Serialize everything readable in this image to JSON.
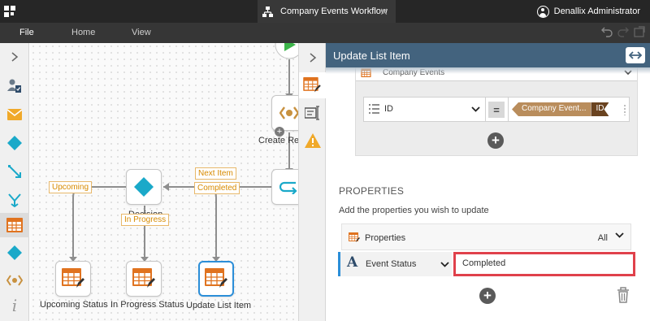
{
  "titlebar": {
    "doc_title": "Company Events Workflow",
    "user_name": "Denallix Administrator"
  },
  "menubar": {
    "items": [
      "File",
      "Home",
      "View"
    ]
  },
  "canvas": {
    "nodes": {
      "create_reference": "Create Ref",
      "decision": "Decision",
      "upcoming_status": "Upcoming Status",
      "in_progress_status": "In Progress Status",
      "update_list_item": "Update List Item"
    },
    "tags": {
      "next_item": "Next Item",
      "completed": "Completed",
      "upcoming": "Upcoming",
      "in_progress": "In Progress"
    }
  },
  "panel": {
    "title": "Update List Item",
    "list_name": "Company Events",
    "criteria": {
      "field": "ID",
      "operator": "=",
      "value_source": "Company Event...",
      "value_field": "ID"
    },
    "properties_title": "PROPERTIES",
    "properties_subtitle": "Add the properties you wish to update",
    "properties_label": "Properties",
    "properties_filter": "All",
    "event_status_label": "Event Status",
    "event_status_value": "Completed"
  },
  "colors": {
    "accent_blue": "#2b8ed8",
    "panel_header": "#43637e",
    "highlight_red": "#e0414b",
    "tag_orange": "#d78a00",
    "list_icon_orange": "#e0731f",
    "diamond_teal": "#1aa9c9"
  }
}
